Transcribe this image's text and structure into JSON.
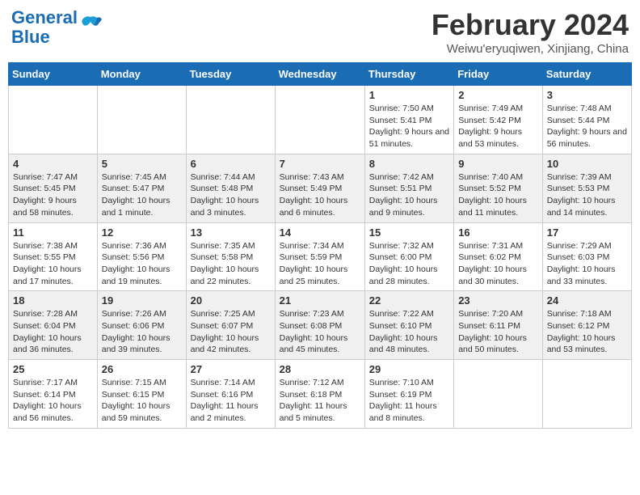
{
  "header": {
    "logo_line1": "General",
    "logo_line2": "Blue",
    "month_year": "February 2024",
    "location": "Weiwu'eryuqiwen, Xinjiang, China"
  },
  "weekdays": [
    "Sunday",
    "Monday",
    "Tuesday",
    "Wednesday",
    "Thursday",
    "Friday",
    "Saturday"
  ],
  "weeks": [
    [
      {
        "day": "",
        "info": ""
      },
      {
        "day": "",
        "info": ""
      },
      {
        "day": "",
        "info": ""
      },
      {
        "day": "",
        "info": ""
      },
      {
        "day": "1",
        "info": "Sunrise: 7:50 AM\nSunset: 5:41 PM\nDaylight: 9 hours and 51 minutes."
      },
      {
        "day": "2",
        "info": "Sunrise: 7:49 AM\nSunset: 5:42 PM\nDaylight: 9 hours and 53 minutes."
      },
      {
        "day": "3",
        "info": "Sunrise: 7:48 AM\nSunset: 5:44 PM\nDaylight: 9 hours and 56 minutes."
      }
    ],
    [
      {
        "day": "4",
        "info": "Sunrise: 7:47 AM\nSunset: 5:45 PM\nDaylight: 9 hours and 58 minutes."
      },
      {
        "day": "5",
        "info": "Sunrise: 7:45 AM\nSunset: 5:47 PM\nDaylight: 10 hours and 1 minute."
      },
      {
        "day": "6",
        "info": "Sunrise: 7:44 AM\nSunset: 5:48 PM\nDaylight: 10 hours and 3 minutes."
      },
      {
        "day": "7",
        "info": "Sunrise: 7:43 AM\nSunset: 5:49 PM\nDaylight: 10 hours and 6 minutes."
      },
      {
        "day": "8",
        "info": "Sunrise: 7:42 AM\nSunset: 5:51 PM\nDaylight: 10 hours and 9 minutes."
      },
      {
        "day": "9",
        "info": "Sunrise: 7:40 AM\nSunset: 5:52 PM\nDaylight: 10 hours and 11 minutes."
      },
      {
        "day": "10",
        "info": "Sunrise: 7:39 AM\nSunset: 5:53 PM\nDaylight: 10 hours and 14 minutes."
      }
    ],
    [
      {
        "day": "11",
        "info": "Sunrise: 7:38 AM\nSunset: 5:55 PM\nDaylight: 10 hours and 17 minutes."
      },
      {
        "day": "12",
        "info": "Sunrise: 7:36 AM\nSunset: 5:56 PM\nDaylight: 10 hours and 19 minutes."
      },
      {
        "day": "13",
        "info": "Sunrise: 7:35 AM\nSunset: 5:58 PM\nDaylight: 10 hours and 22 minutes."
      },
      {
        "day": "14",
        "info": "Sunrise: 7:34 AM\nSunset: 5:59 PM\nDaylight: 10 hours and 25 minutes."
      },
      {
        "day": "15",
        "info": "Sunrise: 7:32 AM\nSunset: 6:00 PM\nDaylight: 10 hours and 28 minutes."
      },
      {
        "day": "16",
        "info": "Sunrise: 7:31 AM\nSunset: 6:02 PM\nDaylight: 10 hours and 30 minutes."
      },
      {
        "day": "17",
        "info": "Sunrise: 7:29 AM\nSunset: 6:03 PM\nDaylight: 10 hours and 33 minutes."
      }
    ],
    [
      {
        "day": "18",
        "info": "Sunrise: 7:28 AM\nSunset: 6:04 PM\nDaylight: 10 hours and 36 minutes."
      },
      {
        "day": "19",
        "info": "Sunrise: 7:26 AM\nSunset: 6:06 PM\nDaylight: 10 hours and 39 minutes."
      },
      {
        "day": "20",
        "info": "Sunrise: 7:25 AM\nSunset: 6:07 PM\nDaylight: 10 hours and 42 minutes."
      },
      {
        "day": "21",
        "info": "Sunrise: 7:23 AM\nSunset: 6:08 PM\nDaylight: 10 hours and 45 minutes."
      },
      {
        "day": "22",
        "info": "Sunrise: 7:22 AM\nSunset: 6:10 PM\nDaylight: 10 hours and 48 minutes."
      },
      {
        "day": "23",
        "info": "Sunrise: 7:20 AM\nSunset: 6:11 PM\nDaylight: 10 hours and 50 minutes."
      },
      {
        "day": "24",
        "info": "Sunrise: 7:18 AM\nSunset: 6:12 PM\nDaylight: 10 hours and 53 minutes."
      }
    ],
    [
      {
        "day": "25",
        "info": "Sunrise: 7:17 AM\nSunset: 6:14 PM\nDaylight: 10 hours and 56 minutes."
      },
      {
        "day": "26",
        "info": "Sunrise: 7:15 AM\nSunset: 6:15 PM\nDaylight: 10 hours and 59 minutes."
      },
      {
        "day": "27",
        "info": "Sunrise: 7:14 AM\nSunset: 6:16 PM\nDaylight: 11 hours and 2 minutes."
      },
      {
        "day": "28",
        "info": "Sunrise: 7:12 AM\nSunset: 6:18 PM\nDaylight: 11 hours and 5 minutes."
      },
      {
        "day": "29",
        "info": "Sunrise: 7:10 AM\nSunset: 6:19 PM\nDaylight: 11 hours and 8 minutes."
      },
      {
        "day": "",
        "info": ""
      },
      {
        "day": "",
        "info": ""
      }
    ]
  ]
}
